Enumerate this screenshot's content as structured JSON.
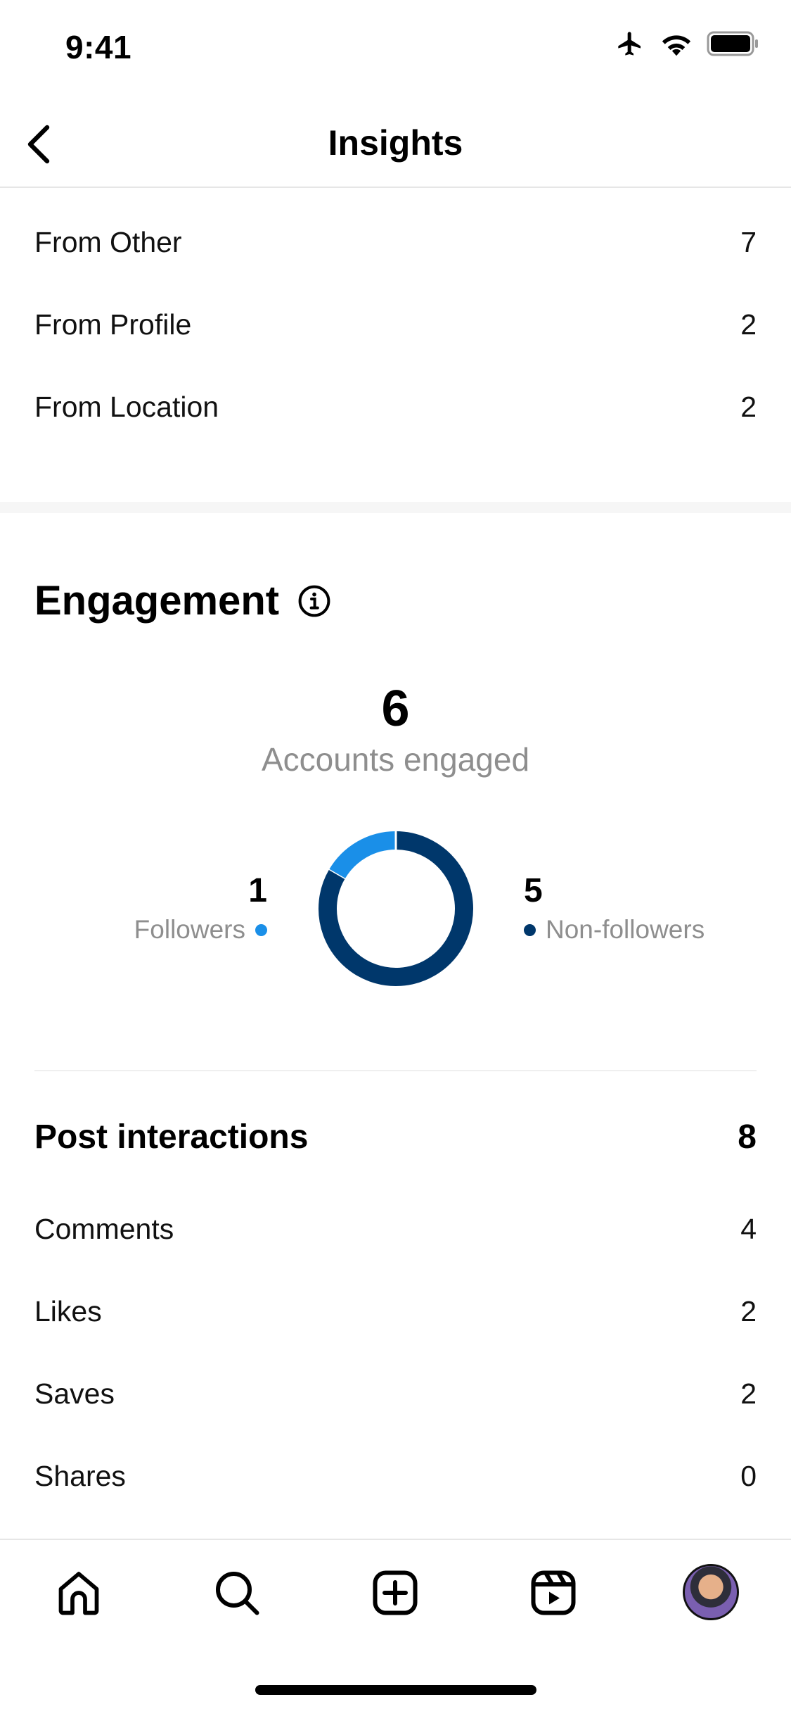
{
  "status": {
    "time": "9:41"
  },
  "header": {
    "title": "Insights"
  },
  "sources": [
    {
      "label": "From Other",
      "value": "7"
    },
    {
      "label": "From Profile",
      "value": "2"
    },
    {
      "label": "From Location",
      "value": "2"
    }
  ],
  "engagement": {
    "title": "Engagement",
    "accounts_engaged": "6",
    "accounts_engaged_label": "Accounts engaged",
    "followers_value": "1",
    "followers_label": "Followers",
    "nonfollowers_value": "5",
    "nonfollowers_label": "Non-followers",
    "colors": {
      "followers": "#1a8fe8",
      "nonfollowers": "#00376b"
    }
  },
  "chart_data": {
    "type": "pie",
    "variant": "donut",
    "categories": [
      "Followers",
      "Non-followers"
    ],
    "values": [
      1,
      5
    ],
    "colors": [
      "#1a8fe8",
      "#00376b"
    ]
  },
  "post_interactions": {
    "title": "Post interactions",
    "total": "8",
    "items": [
      {
        "label": "Comments",
        "value": "4"
      },
      {
        "label": "Likes",
        "value": "2"
      },
      {
        "label": "Saves",
        "value": "2"
      },
      {
        "label": "Shares",
        "value": "0"
      }
    ]
  },
  "tabbar": {
    "icons": [
      "home-icon",
      "search-icon",
      "create-icon",
      "reels-icon",
      "profile-avatar"
    ]
  }
}
